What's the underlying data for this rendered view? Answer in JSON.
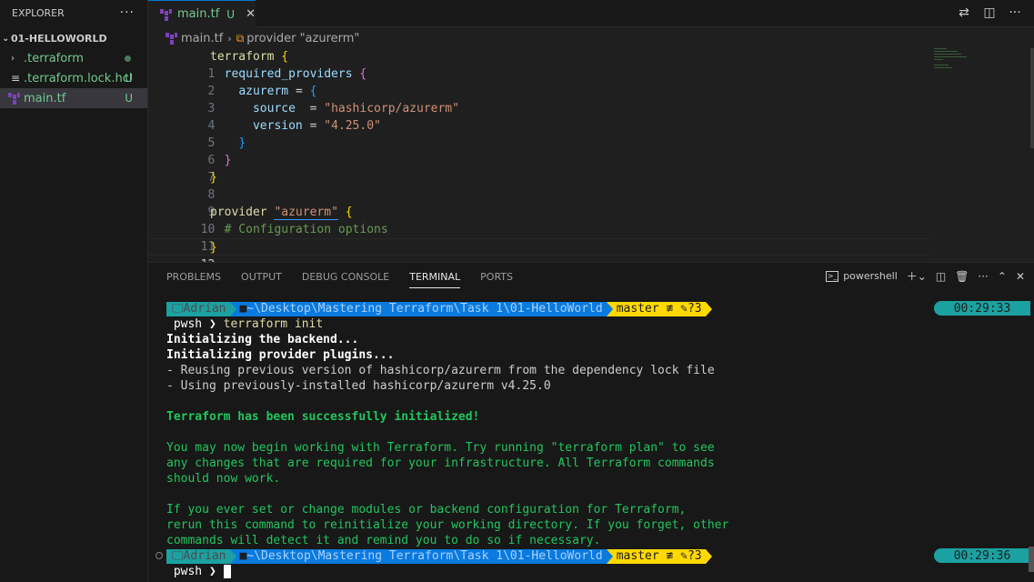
{
  "sidebar": {
    "title": "EXPLORER",
    "more": "···",
    "folder": "01-HELLOWORLD",
    "items": [
      {
        "label": ".terraform",
        "badge": ""
      },
      {
        "label": ".terraform.lock.hcl",
        "badge": "U"
      },
      {
        "label": "main.tf",
        "badge": "U"
      }
    ]
  },
  "tab": {
    "label": "main.tf",
    "status": "U",
    "close": "✕"
  },
  "breadcrumb": {
    "file": "main.tf",
    "symbol": "provider \"azurerm\""
  },
  "editor": {
    "line_numbers": [
      "1",
      "2",
      "3",
      "4",
      "5",
      "6",
      "7",
      "8",
      "9",
      "10",
      "11",
      "12"
    ],
    "l1": {
      "kw": "terraform",
      "br": "{"
    },
    "l2": {
      "prop": "required_providers",
      "br": "{"
    },
    "l3": {
      "prop": "azurerm",
      "eq": "=",
      "br": "{"
    },
    "l4": {
      "prop": "source",
      "eq": "=",
      "str": "\"hashicorp/azurerm\""
    },
    "l5": {
      "prop": "version",
      "eq": "=",
      "str": "\"4.25.0\""
    },
    "l6": {
      "br": "}"
    },
    "l7": {
      "br": "}"
    },
    "l8": {
      "br": "}"
    },
    "l10": {
      "kw": "provider",
      "str": "\"azurerm\"",
      "br": "{"
    },
    "l11": {
      "cmt": "# Configuration options"
    },
    "l12": {
      "br": "}"
    }
  },
  "panel": {
    "tabs": [
      "PROBLEMS",
      "OUTPUT",
      "DEBUG CONSOLE",
      "TERMINAL",
      "PORTS"
    ],
    "shell": "powershell"
  },
  "terminal": {
    "prompt": {
      "user": "Adrian",
      "path": "~\\Desktop\\Mastering Terraform\\Task 1\\01-HelloWorld",
      "git": "master ≢ ",
      "git_changes": "?3"
    },
    "time1": "00:29:33",
    "time2": "00:29:36",
    "ps": "pwsh",
    "command": "terraform init",
    "out": [
      "Initializing the backend...",
      "Initializing provider plugins...",
      "- Reusing previous version of hashicorp/azurerm from the dependency lock file",
      "- Using previously-installed hashicorp/azurerm v4.25.0",
      "Terraform has been successfully initialized!",
      "You may now begin working with Terraform. Try running \"terraform plan\" to see",
      "any changes that are required for your infrastructure. All Terraform commands",
      "should now work.",
      "If you ever set or change modules or backend configuration for Terraform,",
      "rerun this command to reinitialize your working directory. If you forget, other",
      "commands will detect it and remind you to do so if necessary."
    ]
  }
}
